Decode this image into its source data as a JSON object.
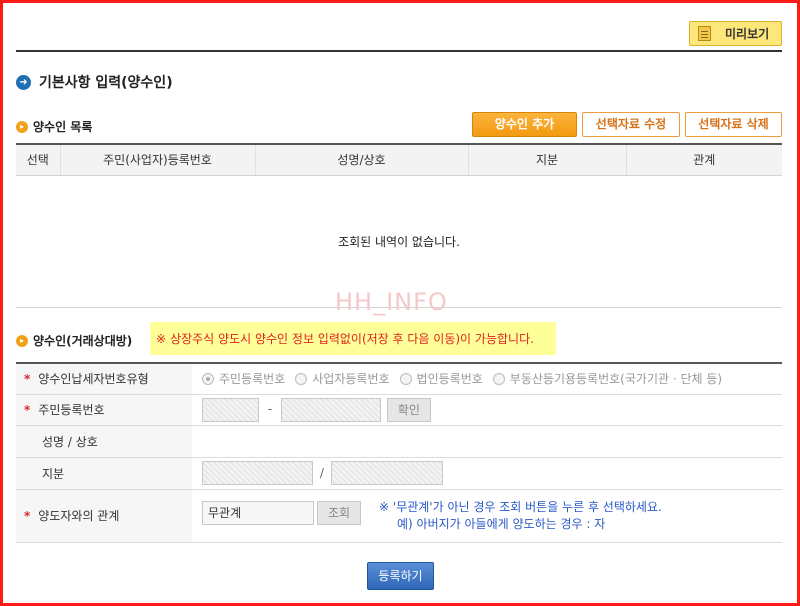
{
  "toolbar": {
    "preview_label": "미리보기"
  },
  "page_title": "기본사항 입력(양수인)",
  "assignee_list": {
    "title": "양수인 목록",
    "add_button": "양수인 추가",
    "edit_button": "선택자료 수정",
    "delete_button": "선택자료 삭제",
    "columns": [
      "선택",
      "주민(사업자)등록번호",
      "성명/상호",
      "지분",
      "관계"
    ],
    "empty_message": "조회된 내역이 없습니다."
  },
  "watermark": "HH_INFO",
  "assignee_form": {
    "title": "양수인(거래상대방)",
    "notice_mark": "※",
    "notice": "상장주식 양도시 양수인 정보 입력없이(저장 후 다음 이동)이 가능합니다.",
    "rows": {
      "taxpayer_type": {
        "label": "양수인납세자번호유형",
        "options": [
          "주민등록번호",
          "사업자등록번호",
          "법인등록번호",
          "부동산등기용등록번호(국가기관 · 단체 등)"
        ]
      },
      "resident_no": {
        "label": "주민등록번호",
        "separator": "-",
        "confirm_button": "확인"
      },
      "name": {
        "label": "성명 / 상호"
      },
      "share": {
        "label": "지분",
        "separator": "/"
      },
      "relation": {
        "label": "양도자와의 관계",
        "value": "무관계",
        "search_button": "조회",
        "hint_line1": "※ '무관계'가 아닌 경우 조회 버튼을 누른 후 선택하세요.",
        "hint_line2": "예) 아버지가 아들에게 양도하는 경우 : 자"
      }
    },
    "required_mark": "*"
  },
  "submit_button": "등록하기"
}
